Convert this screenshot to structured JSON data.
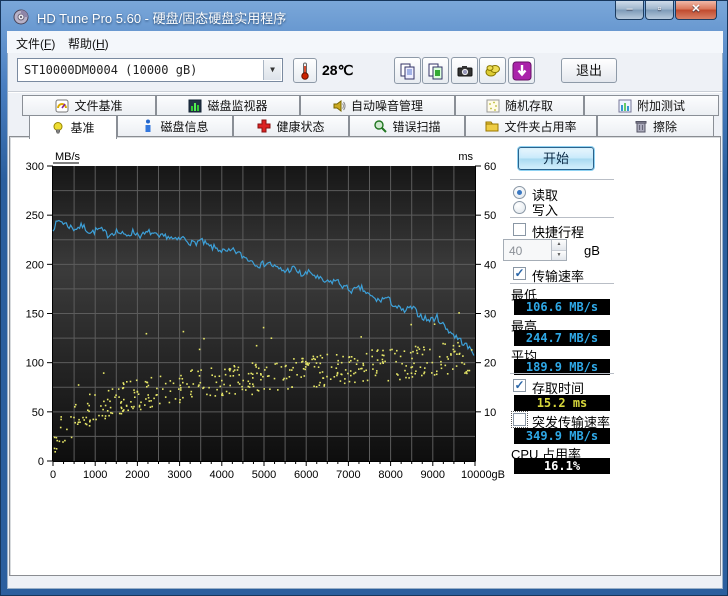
{
  "window": {
    "title": "HD Tune Pro 5.60 - 硬盘/固态硬盘实用程序",
    "caption_buttons": {
      "minimize": "–",
      "maximize": "▫",
      "close": "✕"
    }
  },
  "menu": {
    "items": [
      {
        "name": "file",
        "pre": "文件(",
        "key": "F",
        "post": ")"
      },
      {
        "name": "help",
        "pre": "帮助(",
        "key": "H",
        "post": ")"
      }
    ]
  },
  "toolbar": {
    "drive_selected": "ST10000DM0004  (10000 gB)",
    "temperature": "28℃",
    "buttons": [
      {
        "name": "copy-text"
      },
      {
        "name": "copy-image"
      },
      {
        "name": "screenshot"
      },
      {
        "name": "save-results"
      },
      {
        "name": "update-check"
      }
    ],
    "exit_label": "退出"
  },
  "tabs_top": [
    {
      "label": "文件基准"
    },
    {
      "label": "磁盘监视器"
    },
    {
      "label": "自动噪音管理"
    },
    {
      "label": "随机存取"
    },
    {
      "label": "附加测试"
    }
  ],
  "tabs_bottom": [
    {
      "label": "基准",
      "active": true
    },
    {
      "label": "磁盘信息",
      "active": false
    },
    {
      "label": "健康状态",
      "active": false
    },
    {
      "label": "错误扫描",
      "active": false
    },
    {
      "label": "文件夹占用率",
      "active": false
    },
    {
      "label": "擦除",
      "active": false
    }
  ],
  "panel": {
    "start_label": "开始",
    "mode": {
      "read_label": "读取",
      "write_label": "写入",
      "selected": "read"
    },
    "short_stroke": {
      "label": "快捷行程",
      "checked": false,
      "value": "40",
      "unit": "gB"
    },
    "transfer_rate": {
      "label": "传输速率",
      "checked": true
    },
    "stats": {
      "min": {
        "label": "最低",
        "value": "106.6 MB/s"
      },
      "max": {
        "label": "最高",
        "value": "244.7 MB/s"
      },
      "avg": {
        "label": "平均",
        "value": "189.9 MB/s"
      }
    },
    "access_time": {
      "label": "存取时间",
      "checked": true,
      "value": "15.2 ms"
    },
    "burst_rate": {
      "label": "突发传输速率",
      "checked": false,
      "value": "349.9 MB/s"
    },
    "cpu": {
      "label": "CPU 占用率",
      "value": "16.1%"
    }
  },
  "colors": {
    "line_blue": "#3da0d8",
    "dot_yellow": "#e8e868",
    "grid": "#5c5c5c",
    "lcd_cyan": "#2fa8e6",
    "lcd_yellow": "#d8d83c",
    "lcd_white": "#ffffff"
  },
  "chart_data": {
    "type": "line",
    "title": "",
    "x_axis": {
      "min": 0,
      "max": 10000,
      "ticks": [
        0,
        1000,
        2000,
        3000,
        4000,
        5000,
        6000,
        7000,
        8000,
        9000,
        10000
      ],
      "last_tick_suffix": "gB",
      "minor_grid_step": 500,
      "minor_tick_step": 250
    },
    "y_left": {
      "label": "MB/s",
      "min": 0,
      "max": 300,
      "ticks": [
        0,
        50,
        100,
        150,
        200,
        250,
        300
      ],
      "grid_step": 25
    },
    "y_right": {
      "label": "ms",
      "min": 0,
      "max": 60,
      "ticks": [
        10,
        20,
        30,
        40,
        50,
        60
      ]
    },
    "series": [
      {
        "name": "transfer-rate-read",
        "kind": "line",
        "axis": "left",
        "color": "#3da0d8",
        "summary": {
          "min_mbs": 106.6,
          "max_mbs": 244.7,
          "avg_mbs": 189.9
        },
        "sample_step": 35,
        "noise": 3.4,
        "seed": 7,
        "anchors": [
          [
            0,
            237
          ],
          [
            150,
            245
          ],
          [
            300,
            241
          ],
          [
            500,
            236
          ],
          [
            700,
            239
          ],
          [
            900,
            232
          ],
          [
            1100,
            236
          ],
          [
            1300,
            230
          ],
          [
            1500,
            234
          ],
          [
            1700,
            229
          ],
          [
            1900,
            233
          ],
          [
            2100,
            229
          ],
          [
            2300,
            233
          ],
          [
            2500,
            227
          ],
          [
            2700,
            229
          ],
          [
            2900,
            224
          ],
          [
            3100,
            227
          ],
          [
            3300,
            221
          ],
          [
            3500,
            224
          ],
          [
            3700,
            218
          ],
          [
            3900,
            216
          ],
          [
            4100,
            212
          ],
          [
            4300,
            214
          ],
          [
            4500,
            208
          ],
          [
            4700,
            204
          ],
          [
            4900,
            199
          ],
          [
            5100,
            202
          ],
          [
            5300,
            196
          ],
          [
            5500,
            193
          ],
          [
            5700,
            196
          ],
          [
            5900,
            189
          ],
          [
            6100,
            192
          ],
          [
            6300,
            185
          ],
          [
            6500,
            181
          ],
          [
            6700,
            184
          ],
          [
            6900,
            177
          ],
          [
            7100,
            173
          ],
          [
            7300,
            176
          ],
          [
            7500,
            168
          ],
          [
            7700,
            163
          ],
          [
            7900,
            166
          ],
          [
            8100,
            158
          ],
          [
            8300,
            152
          ],
          [
            8500,
            156
          ],
          [
            8700,
            148
          ],
          [
            8900,
            143
          ],
          [
            9100,
            146
          ],
          [
            9300,
            136
          ],
          [
            9500,
            128
          ],
          [
            9700,
            121
          ],
          [
            9850,
            115
          ],
          [
            10000,
            109
          ]
        ]
      },
      {
        "name": "access-time",
        "kind": "scatter",
        "axis": "right",
        "color": "#e8e868",
        "summary": {
          "avg_ms": 15.2
        },
        "count": 430,
        "spread": 3.2,
        "outlier_chance": 0.035,
        "outlier_extra_ms": 9,
        "seed": 11,
        "trend": [
          [
            0,
            4.5
          ],
          [
            300,
            7
          ],
          [
            600,
            9
          ],
          [
            1000,
            11
          ],
          [
            1500,
            12.5
          ],
          [
            2000,
            13.5
          ],
          [
            2500,
            14.5
          ],
          [
            3000,
            15
          ],
          [
            3500,
            15.5
          ],
          [
            4000,
            16
          ],
          [
            4500,
            16.5
          ],
          [
            5000,
            17
          ],
          [
            5500,
            17.5
          ],
          [
            6000,
            18
          ],
          [
            6500,
            18.5
          ],
          [
            7000,
            19
          ],
          [
            7500,
            19.5
          ],
          [
            8000,
            19.5
          ],
          [
            8500,
            20
          ],
          [
            9000,
            20.5
          ],
          [
            9500,
            21
          ],
          [
            10000,
            21
          ]
        ]
      }
    ]
  }
}
